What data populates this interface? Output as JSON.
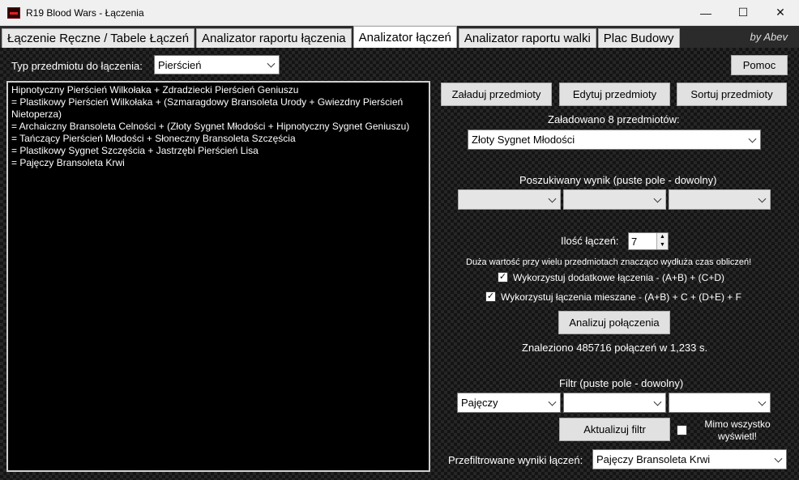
{
  "window": {
    "title": "R19 Blood Wars - Łączenia"
  },
  "tabs": [
    {
      "label": "Łączenie Ręczne / Tabele Łączeń"
    },
    {
      "label": "Analizator raportu łączenia"
    },
    {
      "label": "Analizator łączeń"
    },
    {
      "label": "Analizator raportu walki"
    },
    {
      "label": "Plac Budowy"
    }
  ],
  "author": "by Abev",
  "item_type": {
    "label": "Typ przedmiotu do łączenia:",
    "value": "Pierścień"
  },
  "help_button": "Pomoc",
  "result_lines": [
    "Hipnotyczny Pierścień Wilkołaka + Zdradziecki Pierścień Geniuszu",
    "= Plastikowy Pierścień Wilkołaka + (Szmaragdowy Bransoleta Urody + Gwiezdny Pierścień Nietoperza)",
    "= Archaiczny Bransoleta Celności + (Złoty Sygnet Młodości + Hipnotyczny Sygnet Geniuszu)",
    "= Tańczący Pierścień Młodości + Słoneczny Bransoleta Szczęścia",
    "= Plastikowy Sygnet Szczęścia + Jastrzębi Pierścień Lisa",
    "= Pajęczy Bransoleta Krwi"
  ],
  "buttons": {
    "load": "Załaduj przedmioty",
    "edit": "Edytuj przedmioty",
    "sort": "Sortuj przedmioty",
    "analyze": "Analizuj połączenia",
    "update_filter": "Aktualizuj filtr"
  },
  "loaded_status": "Załadowano 8 przedmiotów:",
  "loaded_item": "Złoty Sygnet Młodości",
  "search_label": "Poszukiwany wynik (puste pole - dowolny)",
  "search_values": [
    "",
    "",
    ""
  ],
  "count": {
    "label": "Ilość łączeń:",
    "value": "7"
  },
  "warning": "Duża wartość przy wielu przedmiotach znacząco wydłuża czas obliczeń!",
  "options": {
    "extra": {
      "label": "Wykorzystuj dodatkowe łączenia - (A+B) + (C+D)",
      "checked": true
    },
    "mixed": {
      "label": "Wykorzystuj łączenia mieszane - (A+B) + C + (D+E) + F",
      "checked": true
    }
  },
  "found_status": "Znaleziono 485716 połączeń w 1,233 s.",
  "filter_label": "Filtr (puste pole - dowolny)",
  "filter_values": [
    "Pajęczy",
    "",
    ""
  ],
  "show_anyway": {
    "label": "Mimo wszystko wyświetl!",
    "checked": false
  },
  "filtered": {
    "label": "Przefiltrowane wyniki łączeń:",
    "value": "Pajęczy Bransoleta Krwi"
  },
  "icons": {
    "minimize": "minimize-icon",
    "maximize": "maximize-icon",
    "close": "close-icon"
  }
}
